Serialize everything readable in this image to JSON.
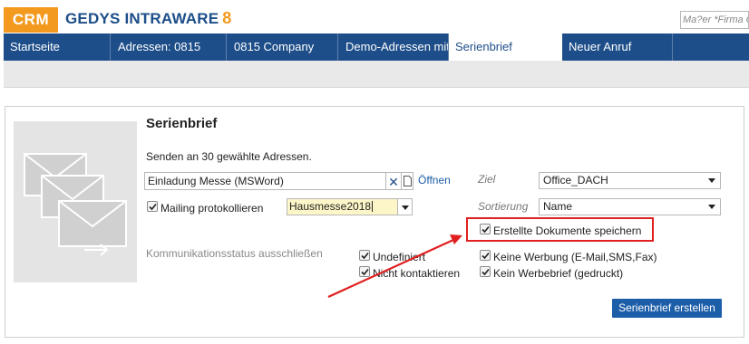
{
  "header": {
    "logo_crm": "CRM",
    "logo_name": "GEDYS INTRAWARE",
    "logo_version": "8",
    "search_placeholder": "Ma?er *Firma G"
  },
  "tabs": [
    {
      "label": "Startseite",
      "active": false
    },
    {
      "label": "Adressen: 0815",
      "active": false
    },
    {
      "label": "0815 Company",
      "active": false
    },
    {
      "label": "Demo-Adressen mit",
      "active": false
    },
    {
      "label": "Serienbrief",
      "active": true
    },
    {
      "label": "Neuer Anruf",
      "active": false
    }
  ],
  "form": {
    "title": "Serienbrief",
    "recipients_text": "Senden an 30 gewählte Adressen.",
    "document_value": "Einladung Messe (MSWord)",
    "open_link": "Öffnen",
    "mailing_checkbox_label": "Mailing protokollieren",
    "mailing_checked": true,
    "mailing_value": "Hausmesse2018",
    "target_label": "Ziel",
    "target_value": "Office_DACH",
    "sort_label": "Sortierung",
    "sort_value": "Name",
    "save_docs_label": "Erstellte Dokumente speichern",
    "save_docs_checked": true,
    "exclude_label": "Kommunikationsstatus ausschließen",
    "status_options": [
      {
        "label": "Undefiniert",
        "checked": true
      },
      {
        "label": "Nicht kontaktieren",
        "checked": true
      },
      {
        "label": "Keine Werbung (E-Mail,SMS,Fax)",
        "checked": true
      },
      {
        "label": "Kein Werbebrief (gedruckt)",
        "checked": true
      }
    ],
    "create_button": "Serienbrief erstellen"
  },
  "colors": {
    "brand_orange": "#f39a1e",
    "brand_blue": "#1d4e89",
    "button_blue": "#1d5ea8",
    "annotation_red": "#e02020",
    "mailing_input_bg": "#fdf6c8"
  }
}
